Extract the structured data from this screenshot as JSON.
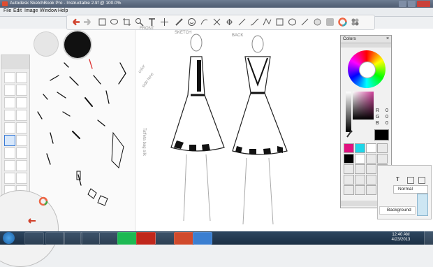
{
  "window": {
    "title": "Autodesk SketchBook Pro - Instructable 2.tif @ 100.0%"
  },
  "menu": {
    "file": "File",
    "edit": "Edit",
    "image": "Image",
    "window": "Window",
    "help": "Help"
  },
  "sketch_notes": {
    "sketch": "SKETCH",
    "back": "BACK",
    "front": "FRONT",
    "color": "color",
    "side_note": "side tone",
    "vertical_note": "Taffeta bag silk"
  },
  "colors_panel": {
    "title": "Colors",
    "r_label": "R",
    "r_value": "0",
    "g_label": "G",
    "g_value": "0",
    "b_label": "B",
    "b_value": "0",
    "current_color": "#000000",
    "swatches": [
      "#e0117f",
      "#1fd6e8",
      "#ffffff",
      "#e9e9e9",
      "#000000",
      "#ffffff",
      "#e9e9e9",
      "#e9e9e9"
    ]
  },
  "layer_panel": {
    "blend_mode": "Normal",
    "layer_name": "Background"
  },
  "taskbar": {
    "time": "12:40 AM",
    "date": "4/23/2013"
  },
  "brush_colors": {
    "primary": "#111111",
    "secondary": "#e6e6e6"
  }
}
